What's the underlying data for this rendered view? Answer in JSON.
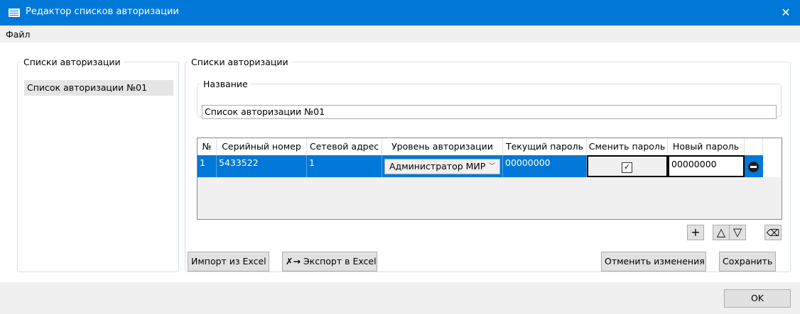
{
  "window": {
    "title": "Редактор списков авторизации",
    "close_glyph": "✕",
    "icon": "list-editor-icon"
  },
  "menu": {
    "items": [
      "Файл"
    ]
  },
  "left_panel": {
    "legend": "Списки авторизации",
    "items": [
      "Список авторизации №01"
    ]
  },
  "right_panel": {
    "legend": "Списки авторизации",
    "name_legend": "Название",
    "name_value": "Список авторизации №01"
  },
  "grid": {
    "columns": [
      "№",
      "Серийный номер",
      "Сетевой адрес",
      "Уровень авторизации",
      "Текущий пароль",
      "Сменить пароль",
      "Новый пароль"
    ],
    "rows": [
      {
        "num": "1",
        "serial": "5433522",
        "address": "1",
        "level": "Администратор МИР",
        "current_password": "00000000",
        "change_password": true,
        "new_password": "00000000"
      }
    ]
  },
  "toolbar": {
    "add_glyph": "+",
    "up_glyph": "△",
    "down_glyph": "▽",
    "clear_icon": "eraser-icon"
  },
  "buttons": {
    "import": "Импорт из Excel",
    "export": "Экспорт в Excel",
    "cancel": "Отменить изменения",
    "save": "Сохранить",
    "ok": "OK"
  },
  "colors": {
    "titlebar": "#0078d7",
    "selection": "#0078d7",
    "background": "#f0f0f0",
    "button": "#e1e1e1"
  }
}
